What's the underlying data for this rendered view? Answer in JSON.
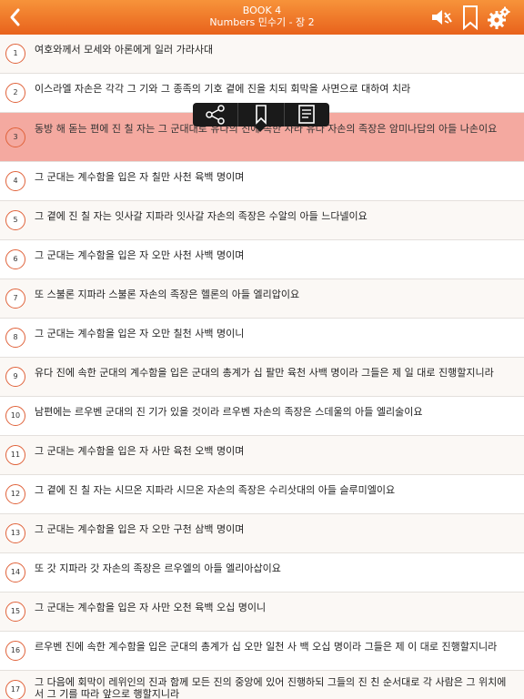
{
  "header": {
    "book": "BOOK 4",
    "chapter": "Numbers 민수기 - 장 2",
    "bg_colors": [
      "#f7933a",
      "#e8621c"
    ],
    "icons": {
      "back": "chevron-left-icon",
      "audio": "speaker-muted-icon",
      "bookmark": "bookmark-icon",
      "settings": "gear-icon"
    }
  },
  "popup": {
    "items": [
      "share-icon",
      "bookmark-icon",
      "note-icon"
    ]
  },
  "verses": [
    {
      "n": "1",
      "text": "여호와께서 모세와 아론에게 일러 가라사대"
    },
    {
      "n": "2",
      "text": "이스라엘 자손은 각각 그 기와 그 종족의 기호 곁에 진을 치되 회막을 사면으로 대하여 치라"
    },
    {
      "n": "3",
      "text": "동방 해 돋는 편에 진 칠 자는 그 군대대로 유다의 진에 속한 자라 유다 자손의 족장은 암미나답의 아들 나손이요",
      "selected": true
    },
    {
      "n": "4",
      "text": "그 군대는 계수함을 입은 자 칠만 사천 육백 명이며"
    },
    {
      "n": "5",
      "text": "그 곁에 진 칠 자는 잇사갈 지파라 잇사갈 자손의 족장은 수알의 아들 느다넬이요"
    },
    {
      "n": "6",
      "text": "그 군대는 계수함을 입은 자 오만 사천 사백 명이며"
    },
    {
      "n": "7",
      "text": "또 스불론 지파라 스불론 자손의 족장은 헬론의 아들 엘리압이요"
    },
    {
      "n": "8",
      "text": "그 군대는 계수함을 입은 자 오만 칠천 사백 명이니"
    },
    {
      "n": "9",
      "text": "유다 진에 속한 군대의 계수함을 입은 군대의 총계가 십 팔만 육천 사백 명이라 그들은 제 일 대로 진행할지니라"
    },
    {
      "n": "10",
      "text": "남편에는 르우벤 군대의 진 기가 있을 것이라 르우벤 자손의 족장은 스데울의 아들 엘리술이요"
    },
    {
      "n": "11",
      "text": "그 군대는 계수함을 입은 자 사만 육천 오백 명이며"
    },
    {
      "n": "12",
      "text": "그 곁에 진 칠 자는 시므온 지파라 시므온 자손의 족장은 수리삿대의 아들 슬루미엘이요"
    },
    {
      "n": "13",
      "text": "그 군대는 계수함을 입은 자 오만 구천 삼백 명이며"
    },
    {
      "n": "14",
      "text": "또 갓 지파라 갓 자손의 족장은 르우엘의 아들 엘리아삽이요"
    },
    {
      "n": "15",
      "text": "그 군대는 계수함을 입은 자 사만 오천 육백 오십 명이니"
    },
    {
      "n": "16",
      "text": "르우벤 진에 속한 계수함을 입은 군대의 총계가 십 오만 일천 사 백 오십 명이라 그들은 제 이 대로 진행할지니라"
    },
    {
      "n": "17",
      "text": "그 다음에 회막이 레위인의 진과 함께 모든 진의 중앙에 있어 진행하되 그들의 진 친 순서대로 각 사람은 그 위치에서 그 기를 따라 앞으로 행할지니라",
      "tall": true
    }
  ]
}
